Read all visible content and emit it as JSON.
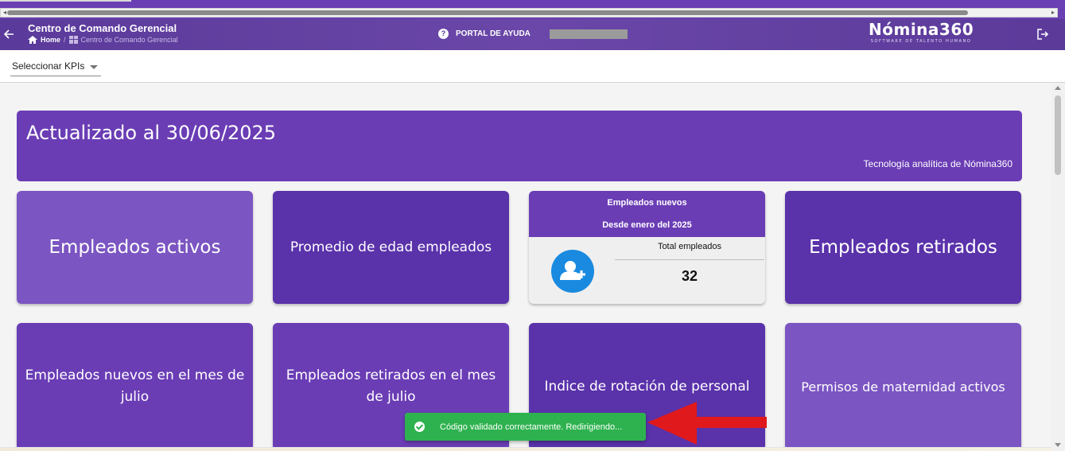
{
  "header": {
    "title": "Centro de Comando Gerencial",
    "breadcrumb": {
      "home": "Home",
      "separator": "/",
      "current": "Centro de Comando Gerencial"
    },
    "help_label": "PORTAL DE AYUDA",
    "brand": "Nómina360",
    "tagline": "SOFTWARE DE TALENTO HUMANO"
  },
  "kpi": {
    "select_label": "Seleccionar KPIs"
  },
  "banner": {
    "title": "Actualizado al 30/06/2025",
    "subtitle": "Tecnología analítica de Nómina360"
  },
  "cards": [
    {
      "label": "Empleados activos",
      "color": "#7b55c2"
    },
    {
      "label": "Promedio de edad empleados",
      "color": "#5a32aa"
    },
    {
      "label": "Empleados retirados",
      "color": "#5a32aa"
    },
    {
      "label": "Empleados nuevos en el mes de julio",
      "color": "#6a3db5"
    },
    {
      "label": "Empleados retirados en el mes de julio",
      "color": "#6a3db5"
    },
    {
      "label": "Indice de rotación de personal",
      "color": "#5a32aa"
    },
    {
      "label": "Permisos de maternidad activos",
      "color": "#7b55c2"
    }
  ],
  "new_employees_card": {
    "title": "Empleados nuevos",
    "subtitle": "Desde enero del 2025",
    "total_label": "Total empleados",
    "total_value": "32",
    "icon": "add-user-icon"
  },
  "toast": {
    "message": "Código validado correctamente. Redirigiendo...",
    "color": "#2eb24f"
  },
  "accent_colors": {
    "primary": "#6a3db5",
    "annotation_arrow": "#e0191c"
  }
}
